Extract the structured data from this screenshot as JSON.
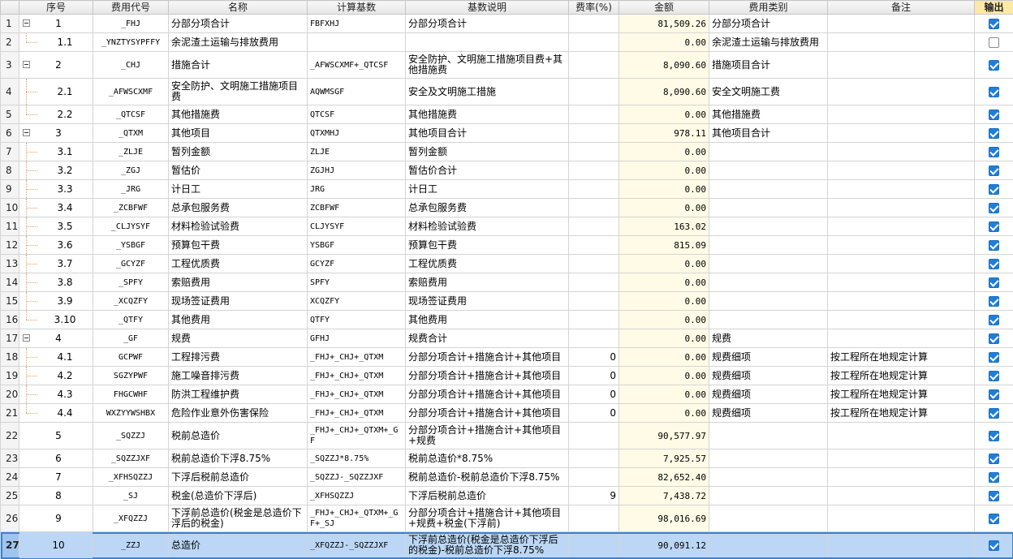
{
  "headers": {
    "seq": "序号",
    "code": "费用代号",
    "name": "名称",
    "base": "计算基数",
    "desc": "基数说明",
    "rate": "费率(%)",
    "amount": "金额",
    "category": "费用类别",
    "note": "备注",
    "output": "输出"
  },
  "rows": [
    {
      "rn": "1",
      "seq": "1",
      "code": "_FHJ",
      "name": "分部分项合计",
      "base": "FBFXHJ",
      "desc": "分部分项合计",
      "rate": "",
      "amount": "81,509.26",
      "category": "分部分项合计",
      "note": "",
      "output": true,
      "level": 0,
      "toggle": true
    },
    {
      "rn": "2",
      "seq": "1.1",
      "code": "_YNZTYSYPFFY",
      "name": "余泥渣土运输与排放费用",
      "base": "",
      "desc": "",
      "rate": "",
      "amount": "0.00",
      "category": "余泥渣土运输与排放费用",
      "note": "",
      "output": false,
      "level": 1,
      "last": true
    },
    {
      "rn": "3",
      "seq": "2",
      "code": "_CHJ",
      "name": "措施合计",
      "base": "_AFWSCXMF+_QTCSF",
      "desc": "安全防护、文明施工措施项目费+其他措施费",
      "rate": "",
      "amount": "8,090.60",
      "category": "措施项目合计",
      "note": "",
      "output": true,
      "level": 0,
      "toggle": true,
      "tall": true
    },
    {
      "rn": "4",
      "seq": "2.1",
      "code": "_AFWSCXMF",
      "name": "安全防护、文明施工措施项目费",
      "base": "AQWMSGF",
      "desc": "安全及文明施工措施",
      "rate": "",
      "amount": "8,090.60",
      "category": "安全文明施工费",
      "note": "",
      "output": true,
      "level": 1,
      "tall": true
    },
    {
      "rn": "5",
      "seq": "2.2",
      "code": "_QTCSF",
      "name": "其他措施费",
      "base": "QTCSF",
      "desc": "其他措施费",
      "rate": "",
      "amount": "0.00",
      "category": "其他措施费",
      "note": "",
      "output": true,
      "level": 1,
      "last": true
    },
    {
      "rn": "6",
      "seq": "3",
      "code": "_QTXM",
      "name": "其他项目",
      "base": "QTXMHJ",
      "desc": "其他项目合计",
      "rate": "",
      "amount": "978.11",
      "category": "其他项目合计",
      "note": "",
      "output": true,
      "level": 0,
      "toggle": true
    },
    {
      "rn": "7",
      "seq": "3.1",
      "code": "_ZLJE",
      "name": "暂列金额",
      "base": "ZLJE",
      "desc": "暂列金额",
      "rate": "",
      "amount": "0.00",
      "category": "",
      "note": "",
      "output": true,
      "level": 1
    },
    {
      "rn": "8",
      "seq": "3.2",
      "code": "_ZGJ",
      "name": "暂估价",
      "base": "ZGJHJ",
      "desc": "暂估价合计",
      "rate": "",
      "amount": "0.00",
      "category": "",
      "note": "",
      "output": true,
      "level": 1
    },
    {
      "rn": "9",
      "seq": "3.3",
      "code": "_JRG",
      "name": "计日工",
      "base": "JRG",
      "desc": "计日工",
      "rate": "",
      "amount": "0.00",
      "category": "",
      "note": "",
      "output": true,
      "level": 1
    },
    {
      "rn": "10",
      "seq": "3.4",
      "code": "_ZCBFWF",
      "name": "总承包服务费",
      "base": "ZCBFWF",
      "desc": "总承包服务费",
      "rate": "",
      "amount": "0.00",
      "category": "",
      "note": "",
      "output": true,
      "level": 1
    },
    {
      "rn": "11",
      "seq": "3.5",
      "code": "_CLJYSYF",
      "name": "材料检验试验费",
      "base": "CLJYSYF",
      "desc": "材料检验试验费",
      "rate": "",
      "amount": "163.02",
      "category": "",
      "note": "",
      "output": true,
      "level": 1
    },
    {
      "rn": "12",
      "seq": "3.6",
      "code": "_YSBGF",
      "name": "预算包干费",
      "base": "YSBGF",
      "desc": "预算包干费",
      "rate": "",
      "amount": "815.09",
      "category": "",
      "note": "",
      "output": true,
      "level": 1
    },
    {
      "rn": "13",
      "seq": "3.7",
      "code": "_GCYZF",
      "name": "工程优质费",
      "base": "GCYZF",
      "desc": "工程优质费",
      "rate": "",
      "amount": "0.00",
      "category": "",
      "note": "",
      "output": true,
      "level": 1
    },
    {
      "rn": "14",
      "seq": "3.8",
      "code": "_SPFY",
      "name": "索赔费用",
      "base": "SPFY",
      "desc": "索赔费用",
      "rate": "",
      "amount": "0.00",
      "category": "",
      "note": "",
      "output": true,
      "level": 1
    },
    {
      "rn": "15",
      "seq": "3.9",
      "code": "_XCQZFY",
      "name": "现场签证费用",
      "base": "XCQZFY",
      "desc": "现场签证费用",
      "rate": "",
      "amount": "0.00",
      "category": "",
      "note": "",
      "output": true,
      "level": 1
    },
    {
      "rn": "16",
      "seq": "3.10",
      "code": "_QTFY",
      "name": "其他费用",
      "base": "QTFY",
      "desc": "其他费用",
      "rate": "",
      "amount": "0.00",
      "category": "",
      "note": "",
      "output": true,
      "level": 1,
      "last": true
    },
    {
      "rn": "17",
      "seq": "4",
      "code": "_GF",
      "name": "规费",
      "base": "GFHJ",
      "desc": "规费合计",
      "rate": "",
      "amount": "0.00",
      "category": "规费",
      "note": "",
      "output": true,
      "level": 0,
      "toggle": true
    },
    {
      "rn": "18",
      "seq": "4.1",
      "code": "GCPWF",
      "name": "工程排污费",
      "base": "_FHJ+_CHJ+_QTXM",
      "desc": "分部分项合计+措施合计+其他项目",
      "rate": "0",
      "amount": "0.00",
      "category": "规费细项",
      "note": "按工程所在地规定计算",
      "output": true,
      "level": 1
    },
    {
      "rn": "19",
      "seq": "4.2",
      "code": "SGZYPWF",
      "name": "施工噪音排污费",
      "base": "_FHJ+_CHJ+_QTXM",
      "desc": "分部分项合计+措施合计+其他项目",
      "rate": "0",
      "amount": "0.00",
      "category": "规费细项",
      "note": "按工程所在地规定计算",
      "output": true,
      "level": 1
    },
    {
      "rn": "20",
      "seq": "4.3",
      "code": "FHGCWHF",
      "name": "防洪工程维护费",
      "base": "_FHJ+_CHJ+_QTXM",
      "desc": "分部分项合计+措施合计+其他项目",
      "rate": "0",
      "amount": "0.00",
      "category": "规费细项",
      "note": "按工程所在地规定计算",
      "output": true,
      "level": 1
    },
    {
      "rn": "21",
      "seq": "4.4",
      "code": "WXZYYWSHBX",
      "name": "危险作业意外伤害保险",
      "base": "_FHJ+_CHJ+_QTXM",
      "desc": "分部分项合计+措施合计+其他项目",
      "rate": "0",
      "amount": "0.00",
      "category": "规费细项",
      "note": "按工程所在地规定计算",
      "output": true,
      "level": 1,
      "last": true
    },
    {
      "rn": "22",
      "seq": "5",
      "code": "_SQZZJ",
      "name": "税前总造价",
      "base": "_FHJ+_CHJ+_QTXM+_GF",
      "desc": "分部分项合计+措施合计+其他项目+规费",
      "rate": "",
      "amount": "90,577.97",
      "category": "",
      "note": "",
      "output": true,
      "level": 0,
      "tall": true
    },
    {
      "rn": "23",
      "seq": "6",
      "code": "_SQZZJXF",
      "name": "税前总造价下浮8.75%",
      "base": "_SQZZJ*8.75%",
      "desc": "税前总造价*8.75%",
      "rate": "",
      "amount": "7,925.57",
      "category": "",
      "note": "",
      "output": true,
      "level": 0
    },
    {
      "rn": "24",
      "seq": "7",
      "code": "_XFHSQZZJ",
      "name": "下浮后税前总造价",
      "base": "_SQZZJ-_SQZZJXF",
      "desc": "税前总造价-税前总造价下浮8.75%",
      "rate": "",
      "amount": "82,652.40",
      "category": "",
      "note": "",
      "output": true,
      "level": 0
    },
    {
      "rn": "25",
      "seq": "8",
      "code": "_SJ",
      "name": "税金(总造价下浮后)",
      "base": "_XFHSQZZJ",
      "desc": "下浮后税前总造价",
      "rate": "9",
      "amount": "7,438.72",
      "category": "",
      "note": "",
      "output": true,
      "level": 0
    },
    {
      "rn": "26",
      "seq": "9",
      "code": "_XFQZZJ",
      "name": "下浮前总造价(税金是总造价下浮后的税金)",
      "base": "_FHJ+_CHJ+_QTXM+_GF+_SJ",
      "desc": "分部分项合计+措施合计+其他项目+规费+税金(下浮前)",
      "rate": "",
      "amount": "98,016.69",
      "category": "",
      "note": "",
      "output": true,
      "level": 0,
      "tall": true
    },
    {
      "rn": "27",
      "seq": "10",
      "code": "_ZZJ",
      "name": "总造价",
      "base": "_XFQZZJ-_SQZZJXF",
      "desc": "下浮前总造价(税金是总造价下浮后的税金)-税前总造价下浮8.75%",
      "rate": "",
      "amount": "90,091.12",
      "category": "",
      "note": "",
      "output": true,
      "level": 0,
      "tall": true,
      "selected": true
    }
  ]
}
